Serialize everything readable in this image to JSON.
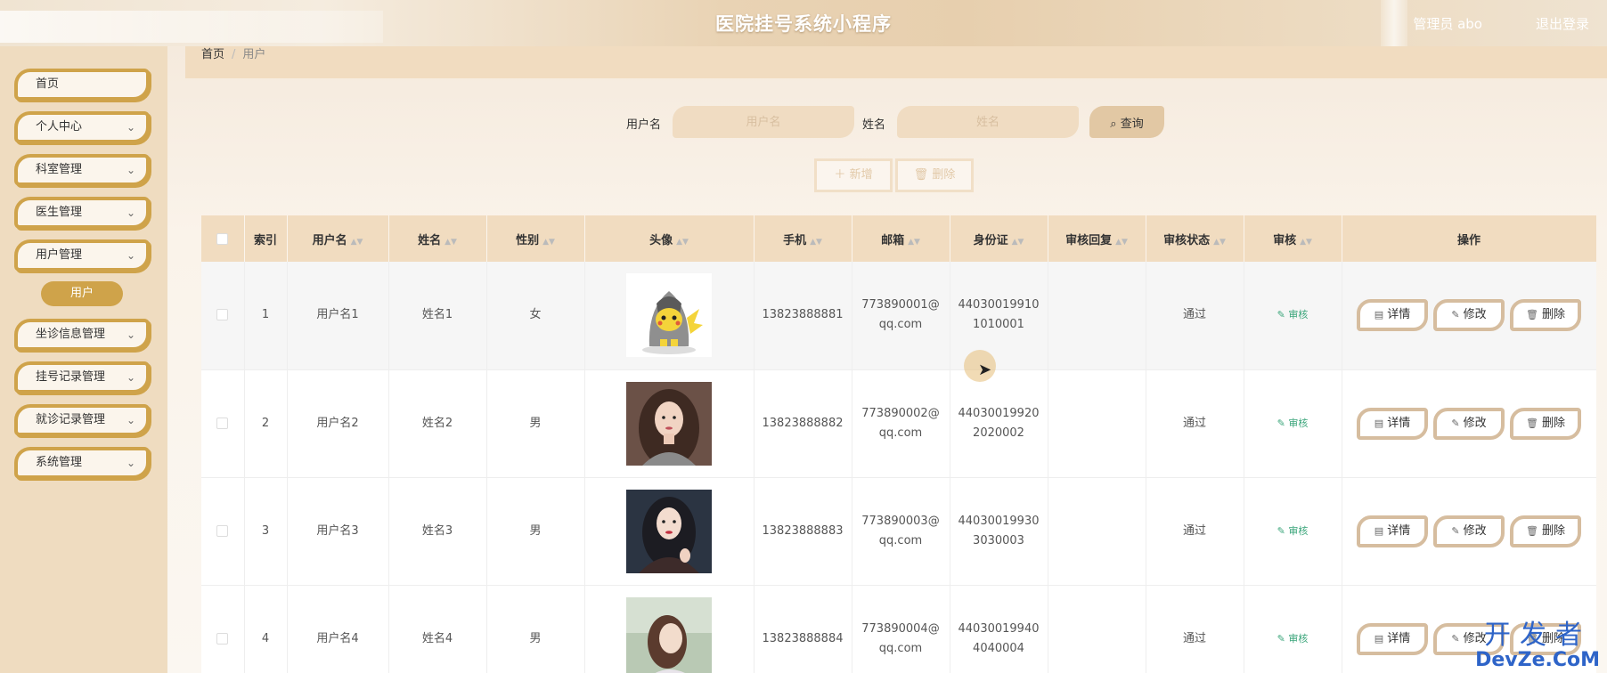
{
  "header": {
    "title": "医院挂号系统小程序",
    "user": "管理员 abo",
    "logout": "退出登录"
  },
  "sidebar": {
    "items": [
      {
        "label": "首页",
        "chevron": false
      },
      {
        "label": "个人中心",
        "chevron": true
      },
      {
        "label": "科室管理",
        "chevron": true
      },
      {
        "label": "医生管理",
        "chevron": true
      },
      {
        "label": "用户管理",
        "chevron": true
      },
      {
        "label": "坐诊信息管理",
        "chevron": true
      },
      {
        "label": "挂号记录管理",
        "chevron": true
      },
      {
        "label": "就诊记录管理",
        "chevron": true
      },
      {
        "label": "系统管理",
        "chevron": true
      }
    ],
    "active_sub": "用户"
  },
  "breadcrumb": {
    "home": "首页",
    "current": "用户"
  },
  "search": {
    "username_label": "用户名",
    "username_placeholder": "用户名",
    "name_label": "姓名",
    "name_placeholder": "姓名",
    "query_label": "查询"
  },
  "toolbar": {
    "add_label": "新增",
    "delete_label": "删除"
  },
  "table": {
    "headers": [
      "索引",
      "用户名",
      "姓名",
      "性别",
      "头像",
      "手机",
      "邮箱",
      "身份证",
      "审核回复",
      "审核状态",
      "审核",
      "操作"
    ],
    "rows": [
      {
        "index": "1",
        "username": "用户名1",
        "name": "姓名1",
        "gender": "女",
        "phone": "13823888881",
        "email_1": "773890001@",
        "email_2": "qq.com",
        "id_1": "44030019910",
        "id_2": "1010001",
        "reply": "",
        "status": "通过",
        "review": "审核"
      },
      {
        "index": "2",
        "username": "用户名2",
        "name": "姓名2",
        "gender": "男",
        "phone": "13823888882",
        "email_1": "773890002@",
        "email_2": "qq.com",
        "id_1": "44030019920",
        "id_2": "2020002",
        "reply": "",
        "status": "通过",
        "review": "审核"
      },
      {
        "index": "3",
        "username": "用户名3",
        "name": "姓名3",
        "gender": "男",
        "phone": "13823888883",
        "email_1": "773890003@",
        "email_2": "qq.com",
        "id_1": "44030019930",
        "id_2": "3030003",
        "reply": "",
        "status": "通过",
        "review": "审核"
      },
      {
        "index": "4",
        "username": "用户名4",
        "name": "姓名4",
        "gender": "男",
        "phone": "13823888884",
        "email_1": "773890004@",
        "email_2": "qq.com",
        "id_1": "44030019940",
        "id_2": "4040004",
        "reply": "",
        "status": "通过",
        "review": "审核"
      }
    ],
    "actions": {
      "detail": "详情",
      "edit": "修改",
      "delete": "删除"
    }
  },
  "watermark": {
    "line1": "开发者",
    "line2": "DevZe.CoM"
  },
  "colors": {
    "accent": "#cfa34a",
    "header_bg": "#f1dcc0",
    "review_link": "#3aa57a"
  }
}
